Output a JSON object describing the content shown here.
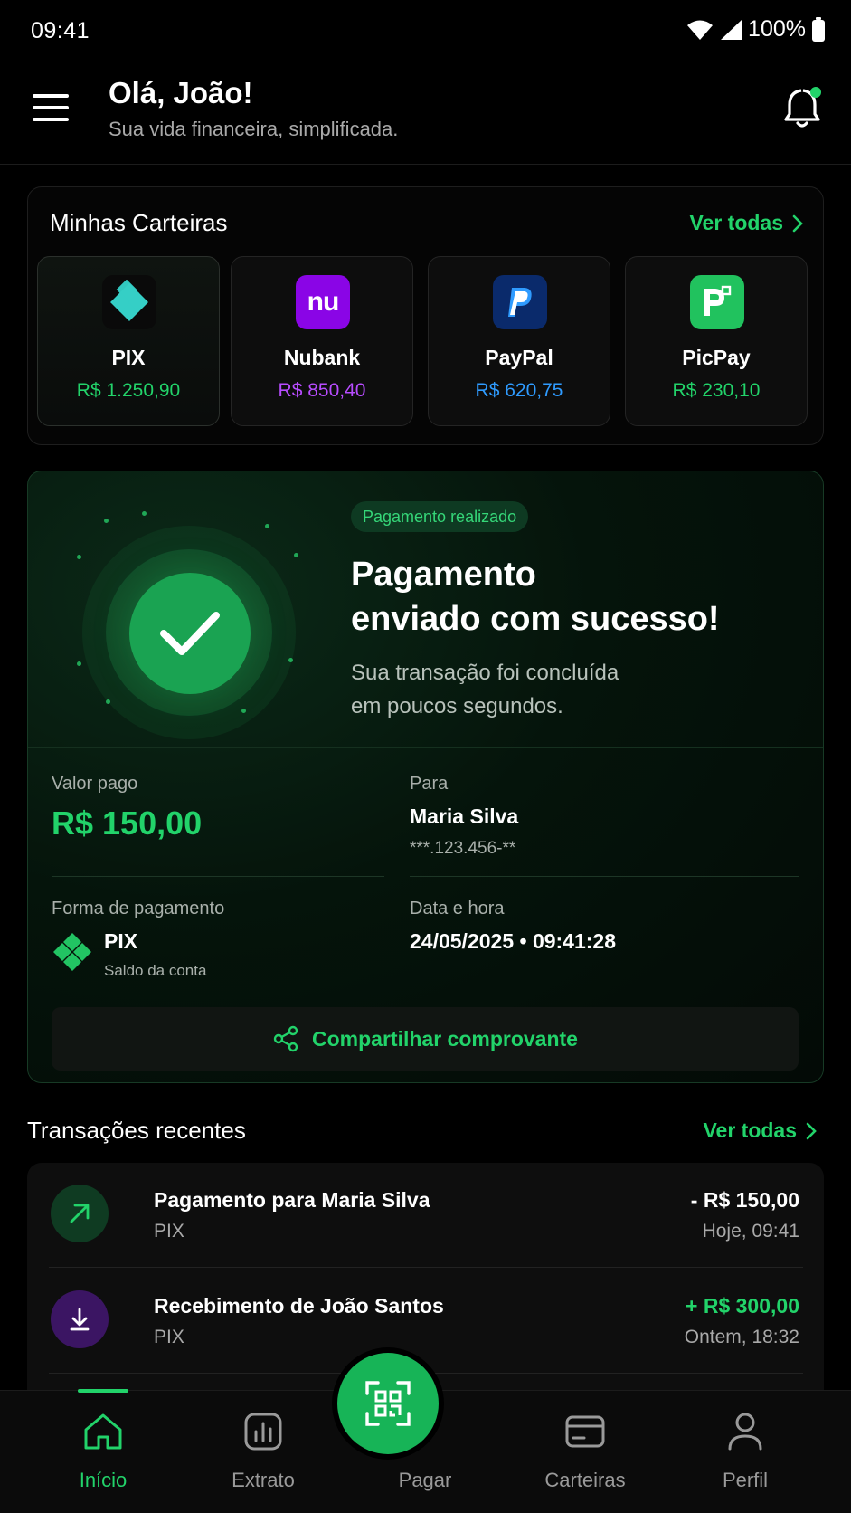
{
  "status_bar": {
    "time": "09:41",
    "battery": "100%"
  },
  "header": {
    "greeting": "Olá, João!",
    "subtitle": "Sua vida financeira, simplificada."
  },
  "wallets": {
    "title": "Minhas Carteiras",
    "see_all": "Ver todas",
    "items": [
      {
        "name": "PIX",
        "balance": "R$ 1.250,90",
        "color": "#22d36a",
        "logo_bg": "#0a0a0a"
      },
      {
        "name": "Nubank",
        "balance": "R$ 850,40",
        "color": "#b84cff",
        "logo_bg": "#8a05e6",
        "logo_text": "nu"
      },
      {
        "name": "PayPal",
        "balance": "R$ 620,75",
        "color": "#2f9bff",
        "logo_bg": "#0a2a6b"
      },
      {
        "name": "PicPay",
        "balance": "R$ 230,10",
        "color": "#22d36a",
        "logo_bg": "#21c25e"
      }
    ]
  },
  "payment": {
    "badge": "Pagamento realizado",
    "title_line1": "Pagamento",
    "title_line2": "enviado com sucesso!",
    "desc_line1": "Sua transação foi concluída",
    "desc_line2": "em poucos segundos.",
    "amount_label": "Valor pago",
    "amount": "R$ 150,00",
    "to_label": "Para",
    "to_name": "Maria Silva",
    "to_doc": "***.123.456-**",
    "method_label": "Forma de pagamento",
    "method": "PIX",
    "method_sub": "Saldo da conta",
    "datetime_label": "Data e hora",
    "datetime": "24/05/2025 • 09:41:28",
    "share": "Compartilhar comprovante"
  },
  "transactions": {
    "title": "Transações recentes",
    "see_all": "Ver todas",
    "items": [
      {
        "name": "Pagamento para Maria Silva",
        "method": "PIX",
        "amount": "- R$ 150,00",
        "time": "Hoje, 09:41",
        "amount_color": "#ffffff"
      },
      {
        "name": "Recebimento de João Santos",
        "method": "PIX",
        "amount": "+ R$ 300,00",
        "time": "Ontem, 18:32",
        "amount_color": "#22d36a"
      }
    ]
  },
  "nav": {
    "home": "Início",
    "statement": "Extrato",
    "pay": "Pagar",
    "wallets": "Carteiras",
    "profile": "Perfil"
  },
  "colors": {
    "accent": "#22d36a",
    "background": "#000000"
  }
}
